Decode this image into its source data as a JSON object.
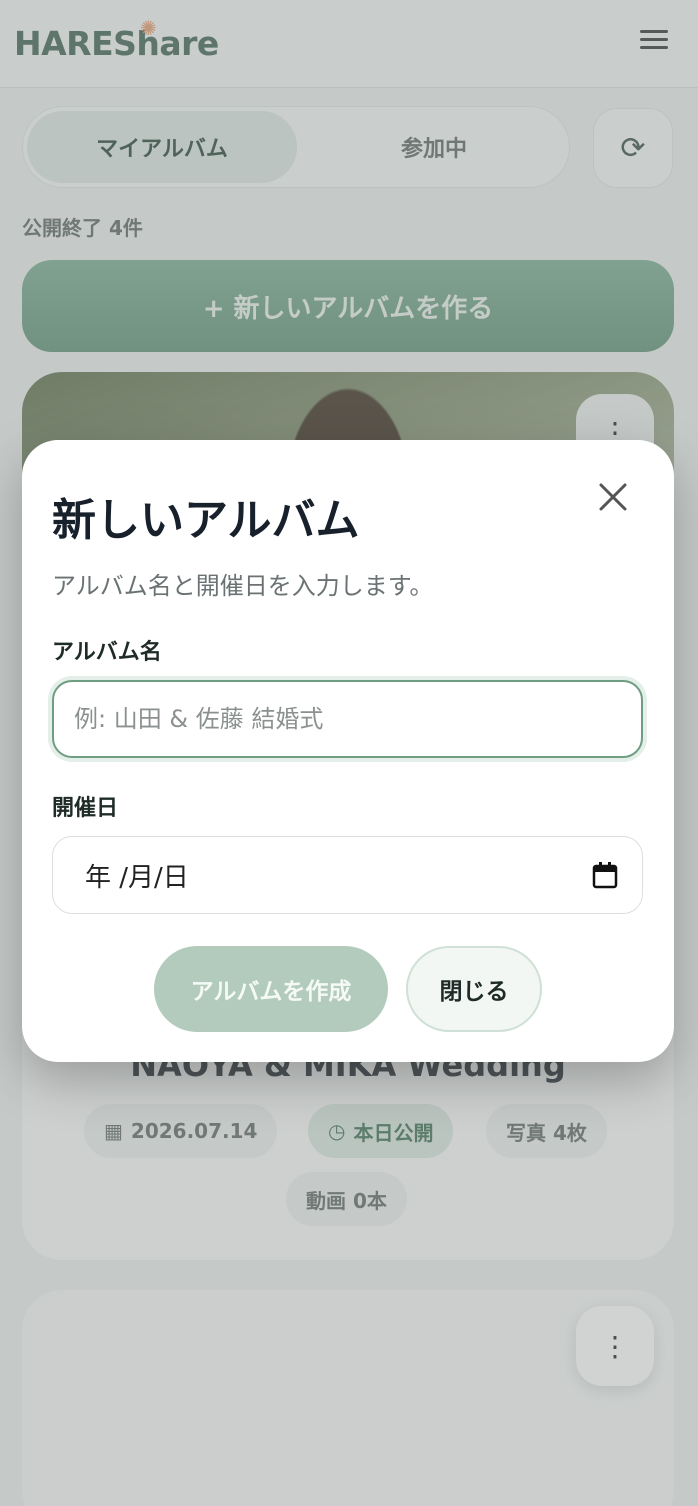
{
  "header": {
    "logo_text": "HAREShare",
    "menu_icon": "hamburger-menu-icon"
  },
  "tabs": [
    {
      "label": "マイアルバム",
      "active": true
    },
    {
      "label": "参加中",
      "active": false
    }
  ],
  "refresh_icon": "refresh-icon",
  "ended_count_text": "公開終了 4件",
  "new_album_button": "+ 新しいアルバムを作る",
  "album_card": {
    "title": "NAOYA & MIKA Wedding",
    "date": "2026.07.14",
    "status": "本日公開",
    "photos": "写真 4枚",
    "videos": "動画 0本"
  },
  "modal": {
    "title": "新しいアルバム",
    "description": "アルバム名と開催日を入力します。",
    "album_name_label": "アルバム名",
    "album_name_placeholder": "例: 山田 & 佐藤 結婚式",
    "album_name_value": "",
    "date_label": "開催日",
    "date_placeholder": "年 /月/日",
    "create_button": "アルバムを作成",
    "close_button": "閉じる"
  },
  "colors": {
    "accent": "#6d9a82",
    "accent_light": "#b3cbbc",
    "title": "#18202b"
  }
}
